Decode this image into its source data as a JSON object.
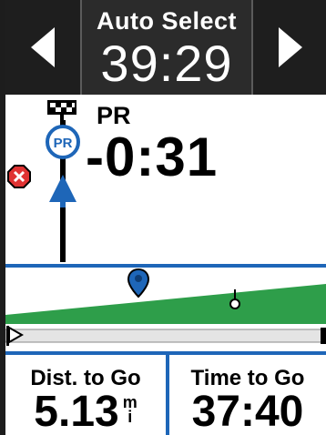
{
  "header": {
    "label": "Auto Select",
    "value": "39:29",
    "prev_icon": "triangle-left-icon",
    "next_icon": "triangle-right-icon"
  },
  "partner": {
    "pr_label": "PR",
    "delta": "-0:31",
    "pr_marker_text": "PR",
    "icons": [
      "finish-flag-icon",
      "pr-marker-icon",
      "off-course-icon",
      "rider-arrow-icon"
    ]
  },
  "elevation": {
    "icons": [
      "location-pin-icon",
      "waypoint-marker-icon",
      "start-flag-icon"
    ]
  },
  "fields": [
    {
      "label": "Dist. to Go",
      "value": "5.13",
      "unit_top": "m",
      "unit_bottom": "i"
    },
    {
      "label": "Time to Go",
      "value": "37:40"
    }
  ],
  "colors": {
    "header_bg": "#2b2b2b",
    "accent_blue": "#1e66b8",
    "terrain_green": "#2e9e4a",
    "alert_red": "#e03333"
  }
}
